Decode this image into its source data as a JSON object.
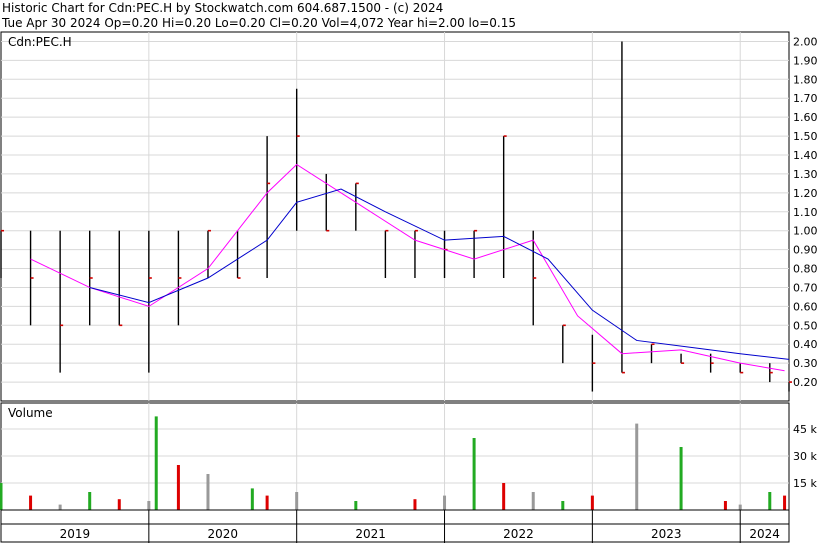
{
  "header": {
    "line1": "Historic Chart for Cdn:PEC.H by Stockwatch.com 604.687.1500 - (c) 2024",
    "line2": "Tue Apr 30 2024  Op=0.20  Hi=0.20  Lo=0.20  Cl=0.20  Vol=4,072  Year hi=2.00  lo=0.15"
  },
  "chart_data": [
    {
      "type": "bar",
      "subtype": "ohlc",
      "title": "Cdn:PEC.H",
      "ylim": [
        0.1,
        2.05
      ],
      "y_ticks": [
        0.2,
        0.3,
        0.4,
        0.5,
        0.6,
        0.7,
        0.8,
        0.9,
        1.0,
        1.1,
        1.2,
        1.3,
        1.4,
        1.5,
        1.6,
        1.7,
        1.8,
        1.9,
        2.0
      ],
      "y_tick_labels": [
        "0.20",
        "0.30",
        "0.40",
        "0.50",
        "0.60",
        "0.70",
        "0.80",
        "0.90",
        "1.00",
        "1.10",
        "1.20",
        "1.30",
        "1.40",
        "1.50",
        "1.60",
        "1.70",
        "1.80",
        "1.90",
        "2.00"
      ],
      "x_ticks": [
        "2019",
        "2020",
        "2021",
        "2022",
        "2023",
        "2024"
      ],
      "grid": true,
      "colors": {
        "price": "#000000",
        "close_up": "#d00000",
        "ma_short": "#ff00ff",
        "ma_long": "#0000cc",
        "grid": "#d8d8d8"
      },
      "series": [
        {
          "kind": "price",
          "x": [
            0,
            0.2,
            0.4,
            0.6,
            0.8,
            1.0,
            1.2,
            1.4,
            1.6,
            1.8,
            2.0,
            2.2,
            2.4,
            2.6,
            2.8,
            3.0,
            3.2,
            3.4,
            3.6,
            3.8,
            4.0,
            4.2,
            4.4,
            4.6,
            4.8,
            5.0,
            5.2,
            5.33
          ],
          "close": [
            1.0,
            0.75,
            0.5,
            0.75,
            0.5,
            0.75,
            0.75,
            1.0,
            0.75,
            1.25,
            1.5,
            1.0,
            1.25,
            1.0,
            1.0,
            0.9,
            1.0,
            1.5,
            0.75,
            0.5,
            0.3,
            0.25,
            0.4,
            0.3,
            0.3,
            0.25,
            0.25,
            0.2
          ],
          "high": [
            1.0,
            1.0,
            1.0,
            1.0,
            1.0,
            1.0,
            1.0,
            1.0,
            1.0,
            1.5,
            1.75,
            1.3,
            1.25,
            1.0,
            1.0,
            1.0,
            1.0,
            1.5,
            1.0,
            0.5,
            0.45,
            2.0,
            0.4,
            0.35,
            0.35,
            0.3,
            0.3,
            0.2
          ],
          "low": [
            0.75,
            0.5,
            0.25,
            0.5,
            0.5,
            0.25,
            0.5,
            0.75,
            0.75,
            0.75,
            1.0,
            1.0,
            1.0,
            0.75,
            0.75,
            0.75,
            0.75,
            0.75,
            0.5,
            0.3,
            0.15,
            0.25,
            0.3,
            0.3,
            0.25,
            0.25,
            0.2,
            0.15
          ]
        },
        {
          "kind": "ma_short",
          "x": [
            0.2,
            0.6,
            1.0,
            1.4,
            1.8,
            2.0,
            2.4,
            2.8,
            3.2,
            3.6,
            3.9,
            4.2,
            4.6,
            5.0,
            5.3
          ],
          "values": [
            0.85,
            0.7,
            0.6,
            0.8,
            1.2,
            1.35,
            1.15,
            0.95,
            0.85,
            0.95,
            0.55,
            0.35,
            0.37,
            0.3,
            0.26
          ]
        },
        {
          "kind": "ma_long",
          "x": [
            0.6,
            1.0,
            1.4,
            1.8,
            2.0,
            2.3,
            2.6,
            3.0,
            3.4,
            3.7,
            4.0,
            4.3,
            4.7,
            5.0,
            5.33
          ],
          "values": [
            0.7,
            0.62,
            0.75,
            0.95,
            1.15,
            1.22,
            1.1,
            0.95,
            0.97,
            0.85,
            0.58,
            0.42,
            0.38,
            0.35,
            0.32
          ]
        }
      ]
    },
    {
      "type": "bar",
      "title": "Volume",
      "unit": "k",
      "ylim": [
        0,
        55
      ],
      "y_ticks": [
        15,
        30,
        45
      ],
      "y_tick_labels": [
        "15 k",
        "30 k",
        "45 k"
      ],
      "x": [
        0,
        0.2,
        0.4,
        0.6,
        0.8,
        1.0,
        1.05,
        1.2,
        1.4,
        1.7,
        1.8,
        2.0,
        2.4,
        2.8,
        3.0,
        3.2,
        3.4,
        3.6,
        3.8,
        4.0,
        4.3,
        4.6,
        4.9,
        5.0,
        5.2,
        5.3
      ],
      "values": [
        15,
        8,
        3,
        10,
        6,
        5,
        52,
        25,
        20,
        12,
        8,
        10,
        5,
        6,
        8,
        40,
        15,
        10,
        5,
        8,
        48,
        35,
        5,
        3,
        10,
        8
      ],
      "colors": {
        "up": "#22aa22",
        "down": "#dd0000",
        "flat": "#999999"
      }
    }
  ]
}
